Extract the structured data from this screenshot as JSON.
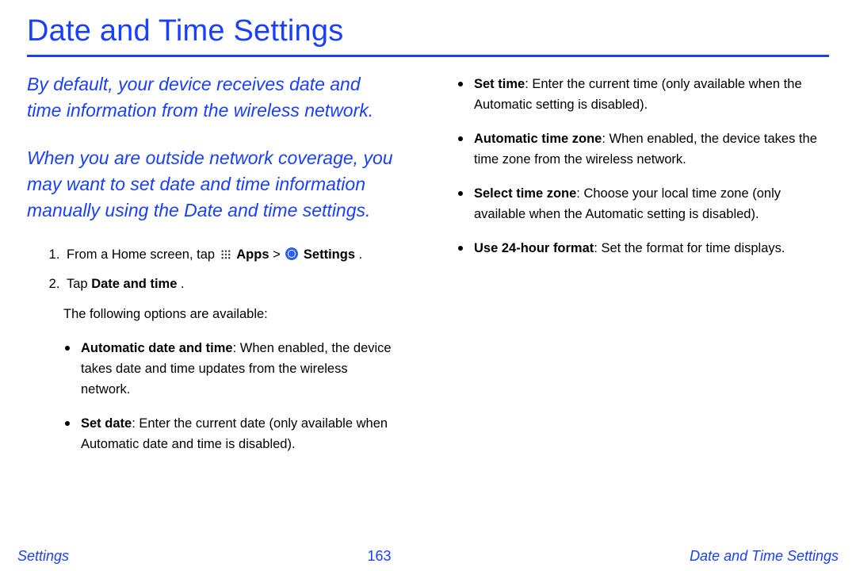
{
  "title": "Date and Time Settings",
  "intro": {
    "p1": "By default, your device receives date and time information from the wireless network.",
    "p2": "When you are outside network coverage, you may want to set date and time information manually using the Date and time settings."
  },
  "steps": {
    "s1_prefix": "From a Home screen, tap ",
    "s1_apps": "Apps",
    "s1_sep": " > ",
    "s1_settings": "Settings",
    "s1_suffix": ".",
    "s2_prefix": "Tap ",
    "s2_bold": "Date and time",
    "s2_suffix": "."
  },
  "options_intro": "The following options are available:",
  "left_bullets": [
    {
      "title": "Automatic date and time",
      "desc": ": When enabled, the device takes date and time updates from the wireless network."
    },
    {
      "title": "Set date",
      "desc": ": Enter the current date (only available when Automatic date and time is disabled)."
    }
  ],
  "right_bullets": [
    {
      "title": "Set time",
      "desc": ": Enter the current time (only available when the Automatic setting is disabled)."
    },
    {
      "title": "Automatic time zone",
      "desc": ": When enabled, the device takes the time zone from the wireless network."
    },
    {
      "title": "Select time zone",
      "desc": ": Choose your local time zone (only available when the Automatic setting is disabled)."
    },
    {
      "title": "Use 24-hour format",
      "desc": ": Set the format for time displays."
    }
  ],
  "footer": {
    "left": "Settings",
    "center": "163",
    "right": "Date and Time Settings"
  }
}
